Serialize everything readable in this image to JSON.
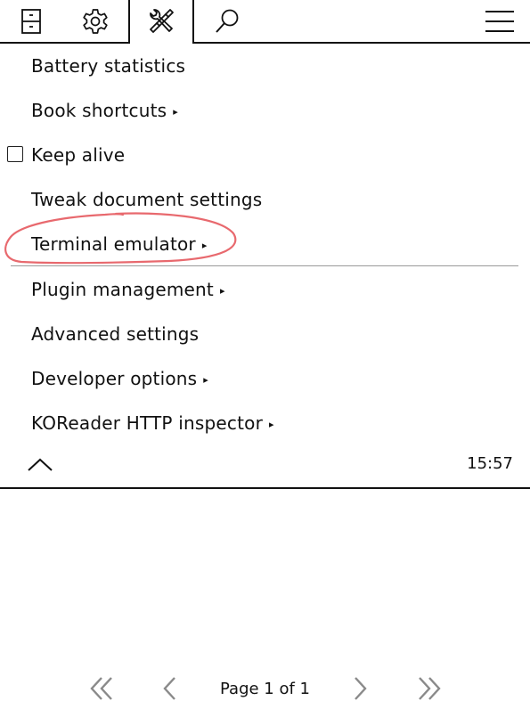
{
  "tabs": [
    {
      "name": "file-browser",
      "icon": "filing-cabinet-icon"
    },
    {
      "name": "settings",
      "icon": "gear-icon"
    },
    {
      "name": "tools",
      "icon": "tools-icon",
      "active": true
    },
    {
      "name": "search",
      "icon": "search-icon"
    },
    {
      "name": "main-menu",
      "icon": "hamburger-menu-icon"
    }
  ],
  "menu": {
    "items": [
      {
        "label": "Battery statistics",
        "submenu": false
      },
      {
        "label": "Book shortcuts",
        "submenu": true,
        "arrow": "▸"
      },
      {
        "label": "Keep alive",
        "checkbox": true,
        "checked": false
      },
      {
        "label": "Tweak document settings",
        "submenu": false
      },
      {
        "label": "Terminal emulator",
        "submenu": true,
        "arrow": "▸",
        "highlighted": true
      },
      {
        "label": "Plugin management",
        "submenu": true,
        "arrow": "▸"
      },
      {
        "label": "Advanced settings",
        "submenu": false
      },
      {
        "label": "Developer options",
        "submenu": true,
        "arrow": "▸"
      },
      {
        "label": "KOReader HTTP inspector",
        "submenu": true,
        "arrow": "▸"
      }
    ]
  },
  "status": {
    "time": "15:57"
  },
  "pagination": {
    "text": "Page 1 of 1"
  },
  "colors": {
    "highlight": "#e8696e",
    "pager_arrow": "#8a8a8a",
    "separator": "#9a9a9a"
  }
}
